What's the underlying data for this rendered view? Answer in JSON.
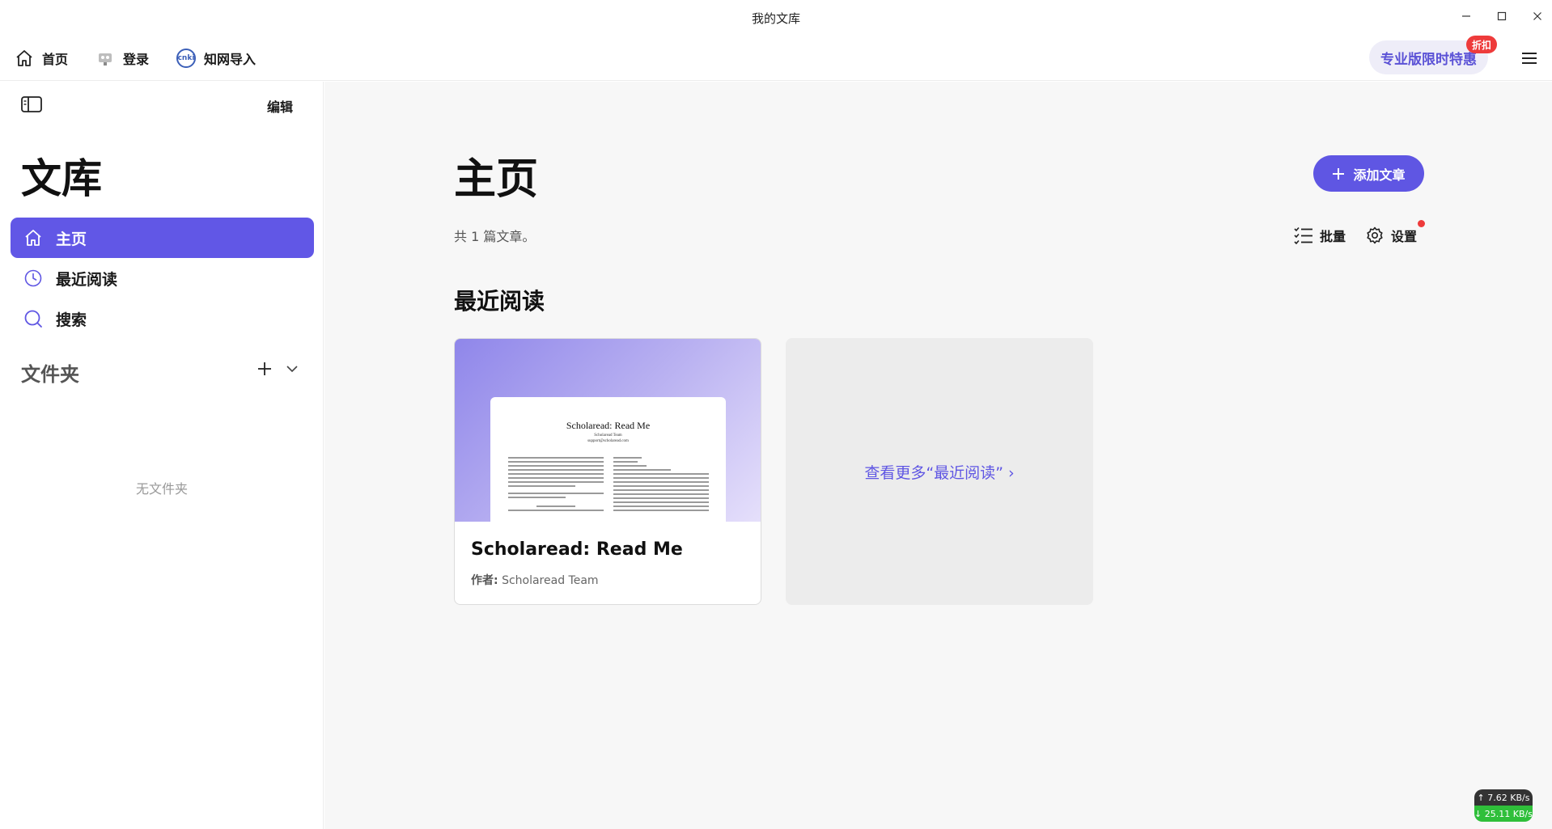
{
  "window": {
    "title": "我的文库",
    "controls": [
      "minimize-icon",
      "maximize-icon",
      "close-icon"
    ]
  },
  "toolbar": {
    "home_label": "首页",
    "login_label": "登录",
    "cnki_label": "知网导入",
    "cnki_badge": "cnki",
    "promo_label": "专业版限时特惠",
    "promo_badge": "折扣"
  },
  "sidebar": {
    "edit_label": "编辑",
    "title": "文库",
    "nav": [
      {
        "label": "主页",
        "icon": "home-icon",
        "active": true
      },
      {
        "label": "最近阅读",
        "icon": "clock-icon",
        "active": false
      },
      {
        "label": "搜索",
        "icon": "search-icon",
        "active": false
      }
    ],
    "folders_title": "文件夹",
    "no_folders": "无文件夹"
  },
  "main": {
    "title": "主页",
    "add_label": "添加文章",
    "count_text": "共 1 篇文章。",
    "batch_label": "批量",
    "settings_label": "设置",
    "recent_title": "最近阅读",
    "card": {
      "title": "Scholaread: Read Me",
      "author_label": "作者:",
      "author": "Scholaread Team",
      "preview_title": "Scholaread: Read Me",
      "preview_team": "Scholaread Team",
      "preview_email": "support@scholaread.com"
    },
    "more_label": "查看更多“最近阅读” ›"
  },
  "netspeed": {
    "up": "↑ 7.62 KB/s",
    "down": "↓ 25.11 KB/s"
  },
  "colors": {
    "accent": "#5f56e3",
    "nav_active": "#6157e6",
    "badge_red": "#ee3b3b",
    "main_bg": "#f7f7f7",
    "more_card_bg": "#ececec"
  }
}
